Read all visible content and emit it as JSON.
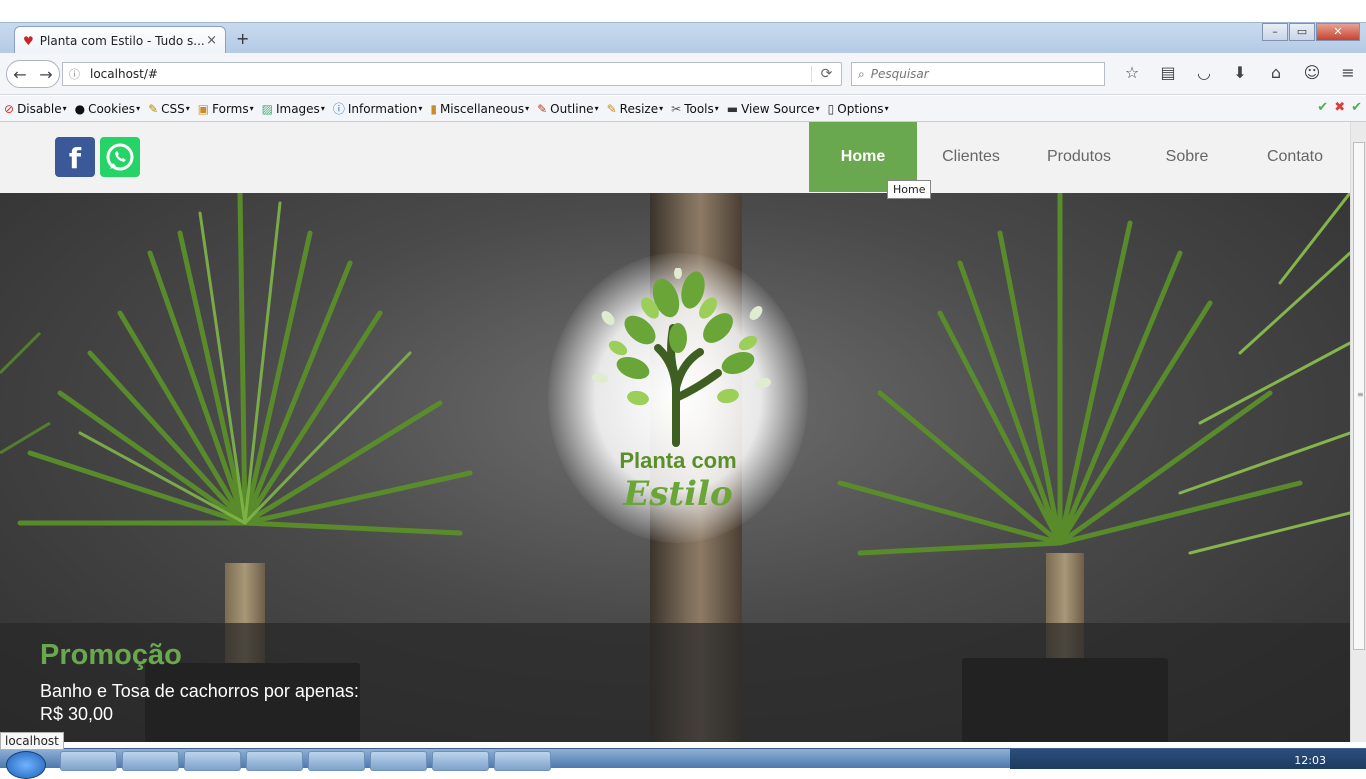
{
  "browser": {
    "tab_title": "Planta com Estilo - Tudo s...",
    "tab_close": "×",
    "new_tab": "+",
    "url": "localhost/#",
    "search_placeholder": "Pesquisar",
    "minimize": "–",
    "restore": "▭",
    "close": "✕"
  },
  "devbar": {
    "items": [
      {
        "label": "Disable",
        "icon": "disable-icon"
      },
      {
        "label": "Cookies",
        "icon": "cookies-icon"
      },
      {
        "label": "CSS",
        "icon": "css-icon"
      },
      {
        "label": "Forms",
        "icon": "forms-icon"
      },
      {
        "label": "Images",
        "icon": "images-icon"
      },
      {
        "label": "Information",
        "icon": "information-icon"
      },
      {
        "label": "Miscellaneous",
        "icon": "miscellaneous-icon"
      },
      {
        "label": "Outline",
        "icon": "outline-icon"
      },
      {
        "label": "Resize",
        "icon": "resize-icon"
      },
      {
        "label": "Tools",
        "icon": "tools-icon"
      },
      {
        "label": "View Source",
        "icon": "view-source-icon"
      },
      {
        "label": "Options",
        "icon": "options-icon"
      }
    ]
  },
  "site": {
    "social": {
      "facebook": "f"
    },
    "nav": [
      "Home",
      "Clientes",
      "Produtos",
      "Sobre",
      "Contato"
    ],
    "tooltip": "Home",
    "logo": {
      "line1": "Planta com",
      "line2": "Estilo"
    },
    "promo": {
      "title": "Promoção",
      "line1": "Banho e Tosa de cachorros por apenas:",
      "line2": "R$ 30,00"
    }
  },
  "status_text": "localhost",
  "taskbar": {
    "clock": "12:03"
  },
  "colors": {
    "accent": "#6aa84f",
    "facebook": "#3b5998",
    "whatsapp": "#25d366"
  }
}
